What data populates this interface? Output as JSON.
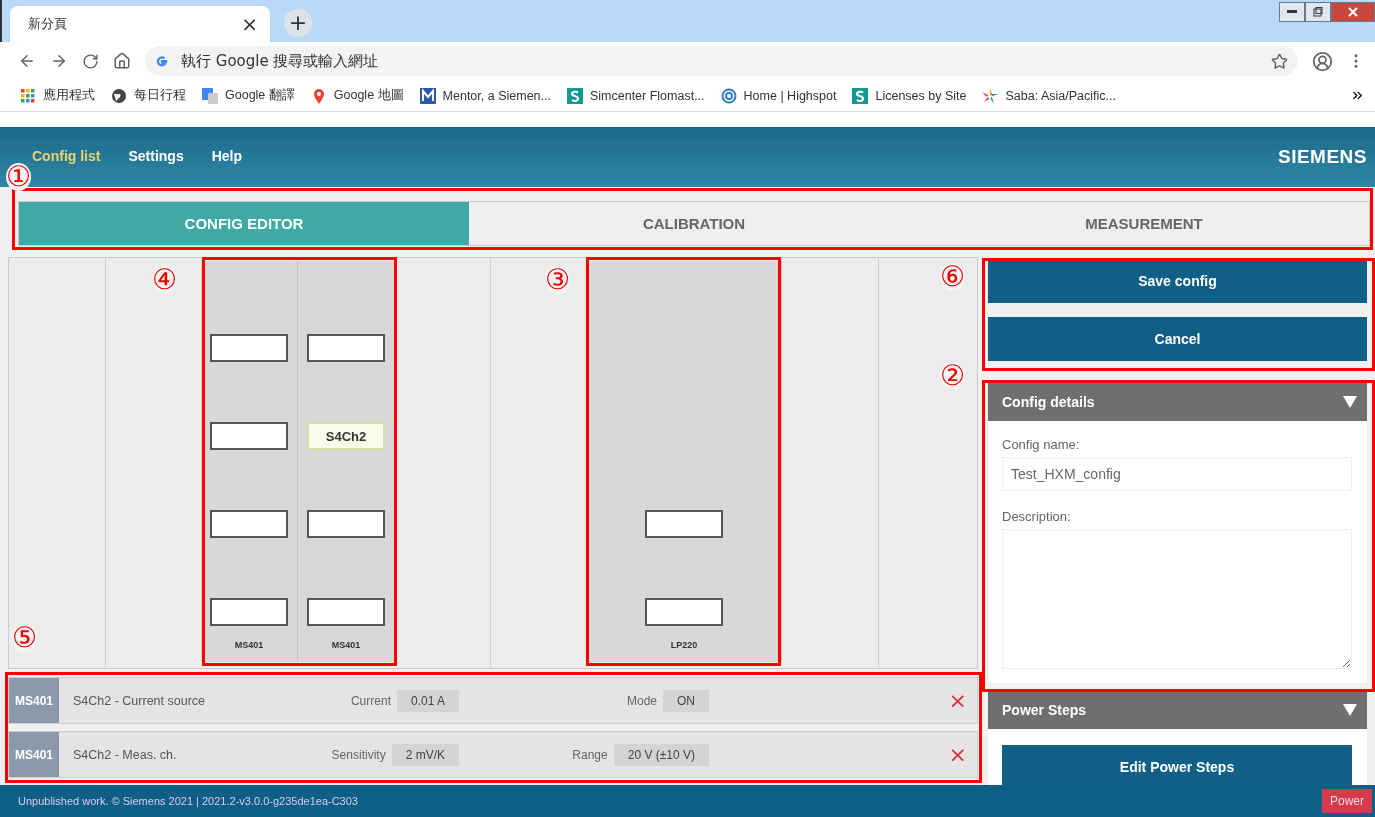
{
  "browser": {
    "tab": {
      "title": "新分頁",
      "close": "×",
      "new_tab": "+"
    },
    "address": {
      "placeholder": "執行 Google 搜尋或輸入網址"
    },
    "bookmarks": [
      {
        "label": "應用程式"
      },
      {
        "label": "每日行程"
      },
      {
        "label": "Google 翻譯"
      },
      {
        "label": "Google 地圖"
      },
      {
        "label": "Mentor, a Siemen..."
      },
      {
        "label": "Simcenter Flomast..."
      },
      {
        "label": "Home | Highspot"
      },
      {
        "label": "Licenses by Site"
      },
      {
        "label": "Saba: Asia/Pacific..."
      }
    ]
  },
  "app": {
    "nav": [
      {
        "label": "Config list",
        "selected": true
      },
      {
        "label": "Settings",
        "selected": false
      },
      {
        "label": "Help",
        "selected": false
      }
    ],
    "logo": "SIEMENS",
    "tabs": [
      {
        "label": "CONFIG EDITOR",
        "selected": true
      },
      {
        "label": "CALIBRATION",
        "selected": false
      },
      {
        "label": "MEASUREMENT",
        "selected": false
      }
    ],
    "rack": {
      "bays": [
        {
          "modules": [
            {
              "label": "MS401",
              "slots": [
                {
                  "selected": false
                },
                {
                  "selected": false
                },
                {
                  "selected": false
                },
                {
                  "selected": false
                }
              ]
            },
            {
              "label": "MS401",
              "slots": [
                {
                  "selected": false
                },
                {
                  "label": "S4Ch2",
                  "selected": true
                },
                {
                  "selected": false
                },
                {
                  "selected": false
                }
              ]
            }
          ]
        },
        {
          "modules": [
            {
              "label": "LP220",
              "slots": [
                {
                  "selected": false
                },
                {
                  "selected": false
                }
              ]
            }
          ]
        }
      ]
    },
    "channels": [
      {
        "module": "MS401",
        "name": "S4Ch2 - Current source",
        "fields": [
          {
            "label": "Current",
            "value": "0.01 A"
          },
          {
            "label": "Mode",
            "value": "ON"
          }
        ],
        "remove": "×"
      },
      {
        "module": "MS401",
        "name": "S4Ch2 - Meas. ch.",
        "fields": [
          {
            "label": "Sensitivity",
            "value": "2 mV/K"
          },
          {
            "label": "Range",
            "value": "20 V (±10 V)"
          }
        ],
        "remove": "×"
      }
    ],
    "actions": [
      "Save config",
      "Cancel"
    ],
    "config_details": {
      "title": "Config details",
      "expanded": true,
      "name_label": "Config name:",
      "name_value": "Test_HXM_config",
      "description_label": "Description:"
    },
    "power_steps": {
      "title": "Power Steps",
      "expanded": true,
      "button": "Edit Power Steps"
    },
    "footer": {
      "text": "Unpublished work. © Siemens 2021 | 2021.2-v3.0.0-g235de1ea-C303",
      "power": "Power"
    }
  },
  "annotations": [
    {
      "label": "①"
    },
    {
      "label": "④"
    },
    {
      "label": "③"
    },
    {
      "label": "⑥"
    },
    {
      "label": "②"
    },
    {
      "label": "⑤"
    }
  ]
}
